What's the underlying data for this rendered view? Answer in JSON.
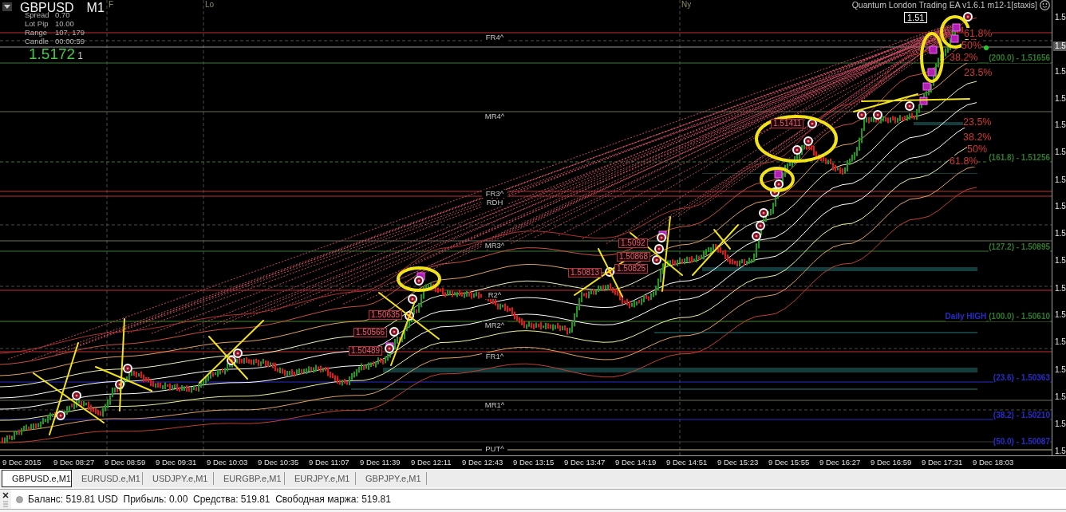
{
  "chart": {
    "symbol": "GBPUSD",
    "timeframe": "M1",
    "info": [
      {
        "label": "Spread",
        "value": "0.70"
      },
      {
        "label": "Lot Pip",
        "value": "10.00"
      },
      {
        "label": "Range",
        "value": "107, 179"
      },
      {
        "label": "Candle",
        "value": "00:00:59"
      }
    ],
    "bid": {
      "price": "1.5172",
      "pipette": "1"
    },
    "sessions": [
      "F",
      "Lo",
      "Ny"
    ],
    "ea_title": "Quantum London Trading EA v1.6.1 m12-1[staxis]",
    "price_tag": "1.51",
    "pivot_labels": [
      "FR4^",
      "MR4^",
      "FR3^",
      "RDH",
      "MR3^",
      "R2^",
      "MR2^",
      "FR1^",
      "MR1^",
      "PUT^"
    ],
    "fib_labels": [
      "61.8%",
      "50%",
      "38.2%",
      "23.5%",
      "23.5%",
      "38.2%",
      "50%",
      "61.8%"
    ],
    "level_labels": [
      {
        "text": "(200.0) - 1.51656",
        "color": "#2f7a2f"
      },
      {
        "text": "(161.8) - 1.51256",
        "color": "#2f7a2f"
      },
      {
        "text": "(127.2) - 1.50895",
        "color": "#2f7a2f"
      },
      {
        "name": "Daily HIGH",
        "text": "(100.0) - 1.50610",
        "color": "#2f7a2f"
      },
      {
        "text": "(23.6) - 1.50363",
        "color": "#2a2ac8"
      },
      {
        "text": "(38.2) - 1.50210",
        "color": "#2a2ac8"
      },
      {
        "text": "(50.0) - 1.50087",
        "color": "#2a2ac8"
      }
    ],
    "order_labels": [
      "1.51411",
      "1.5092",
      "1.50868",
      "1.50825",
      "1.50813",
      "1.50635",
      "1.50566",
      "1.50489"
    ],
    "price_axis": [
      "1.5",
      "1.5",
      "1.5",
      "1.5",
      "1.5",
      "1.5",
      "1.5",
      "1.5",
      "1.5",
      "1.5",
      "1.5",
      "1.5",
      "1.5",
      "1.5",
      "1.5",
      "1.5"
    ],
    "current_price": "1.5",
    "time_axis": [
      "9 Dec 2015",
      "9 Dec 08:27",
      "9 Dec 08:59",
      "9 Dec 09:31",
      "9 Dec 10:03",
      "9 Dec 10:35",
      "9 Dec 11:07",
      "9 Dec 11:39",
      "9 Dec 12:11",
      "9 Dec 12:43",
      "9 Dec 13:15",
      "9 Dec 13:47",
      "9 Dec 14:19",
      "9 Dec 14:51",
      "9 Dec 15:23",
      "9 Dec 15:55",
      "9 Dec 16:27",
      "9 Dec 16:59",
      "9 Dec 17:31",
      "9 Dec 18:03"
    ]
  },
  "tabs": [
    {
      "label": "GBPUSD.e,M1",
      "selected": true
    },
    {
      "label": "EURUSD.e,M1",
      "selected": false
    },
    {
      "label": "USDJPY.e,M1",
      "selected": false
    },
    {
      "label": "EURGBP.e,M1",
      "selected": false
    },
    {
      "label": "EURJPY.e,M1",
      "selected": false
    },
    {
      "label": "GBPJPY.e,M1",
      "selected": false
    }
  ],
  "status_bar": {
    "text": "Баланс: 519.81 USD  Прибыль: 0.00  Средства: 519.81  Свободная маржа: 519.81"
  }
}
